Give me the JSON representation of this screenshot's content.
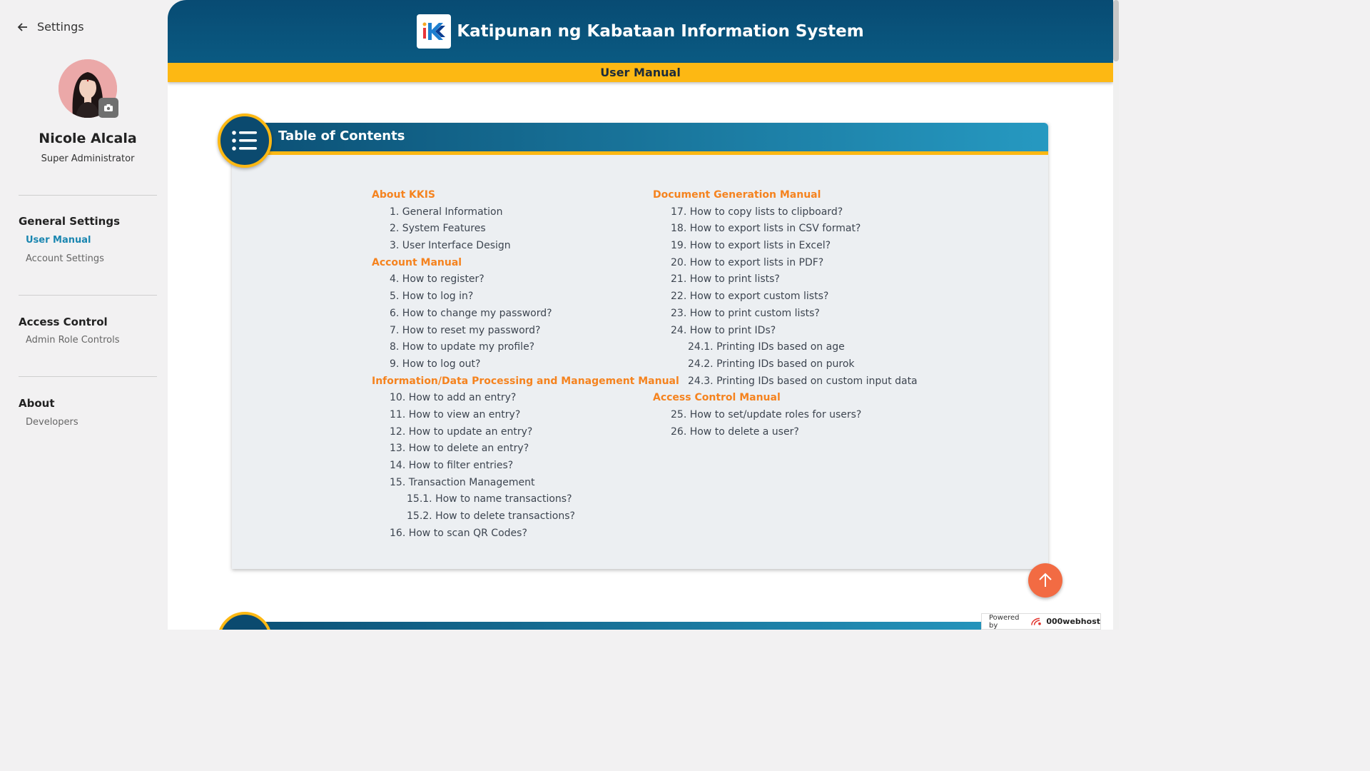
{
  "sidebar": {
    "back_label": "Settings",
    "user": {
      "name": "Nicole Alcala",
      "role": "Super Administrator"
    },
    "sections": [
      {
        "title": "General Settings",
        "items": [
          "User Manual",
          "Account Settings"
        ]
      },
      {
        "title": "Access Control",
        "items": [
          "Admin Role Controls"
        ]
      },
      {
        "title": "About",
        "items": [
          "Developers"
        ]
      }
    ],
    "active_item": "User Manual"
  },
  "header": {
    "app_title": "Katipunan ng Kabataan Information System",
    "page_title": "User Manual"
  },
  "toc": {
    "title": "Table of Contents",
    "left_column": [
      {
        "type": "cat",
        "text": "About KKIS"
      },
      {
        "type": "item",
        "text": "1. General Information"
      },
      {
        "type": "item",
        "text": "2. System Features"
      },
      {
        "type": "item",
        "text": "3. User Interface Design"
      },
      {
        "type": "cat",
        "text": "Account Manual"
      },
      {
        "type": "item",
        "text": "4. How to register?"
      },
      {
        "type": "item",
        "text": "5. How to log in?"
      },
      {
        "type": "item",
        "text": "6. How to change my password?"
      },
      {
        "type": "item",
        "text": "7. How to reset my password?"
      },
      {
        "type": "item",
        "text": "8. How to update my profile?"
      },
      {
        "type": "item",
        "text": "9. How to log out?"
      },
      {
        "type": "cat",
        "text": "Information/Data Processing and Management Manual"
      },
      {
        "type": "item",
        "text": "10. How to add an entry?"
      },
      {
        "type": "item",
        "text": "11. How to view an entry?"
      },
      {
        "type": "item",
        "text": "12. How to update an entry?"
      },
      {
        "type": "item",
        "text": "13. How to delete an entry?"
      },
      {
        "type": "item",
        "text": "14. How to filter entries?"
      },
      {
        "type": "item",
        "text": "15. Transaction Management"
      },
      {
        "type": "sub",
        "text": "15.1. How to name transactions?"
      },
      {
        "type": "sub",
        "text": "15.2. How to delete transactions?"
      },
      {
        "type": "item",
        "text": "16. How to scan QR Codes?"
      }
    ],
    "right_column": [
      {
        "type": "cat",
        "text": "Document Generation Manual"
      },
      {
        "type": "item",
        "text": "17. How to copy lists to clipboard?"
      },
      {
        "type": "item",
        "text": "18. How to export lists in CSV format?"
      },
      {
        "type": "item",
        "text": "19. How to export lists in Excel?"
      },
      {
        "type": "item",
        "text": "20. How to export lists in PDF?"
      },
      {
        "type": "item",
        "text": "21. How to print lists?"
      },
      {
        "type": "item",
        "text": "22. How to export custom lists?"
      },
      {
        "type": "item",
        "text": "23. How to print custom lists?"
      },
      {
        "type": "item",
        "text": "24. How to print IDs?"
      },
      {
        "type": "sub",
        "text": "24.1. Printing IDs based on age"
      },
      {
        "type": "sub",
        "text": "24.2. Printing IDs based on purok"
      },
      {
        "type": "sub",
        "text": "24.3. Printing IDs based on custom input data"
      },
      {
        "type": "cat",
        "text": "Access Control Manual"
      },
      {
        "type": "item",
        "text": "25. How to set/update roles for users?"
      },
      {
        "type": "item",
        "text": "26. How to delete a user?"
      }
    ]
  },
  "footer": {
    "powered_prefix": "Powered by",
    "powered_brand": "000webhost"
  },
  "colors": {
    "header_blue": "#084b73",
    "accent_yellow": "#fdb813",
    "category_orange": "#f5831f",
    "active_link": "#1a86b0",
    "scroll_button": "#f26b43"
  },
  "icons": {
    "back": "arrow-left-icon",
    "camera": "camera-icon",
    "toc": "list-icon",
    "scroll_top": "arrow-up-icon"
  }
}
